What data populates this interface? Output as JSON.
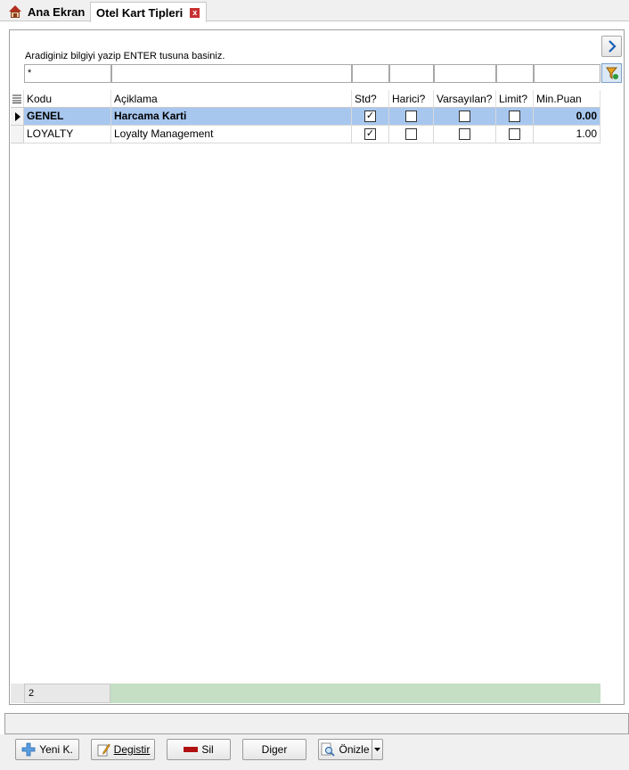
{
  "tabs": {
    "home_label": "Ana Ekran",
    "active_label": "Otel Kart Tipleri",
    "close_glyph": "x"
  },
  "search": {
    "hint": "Aradiginiz bilgiyi yazip ENTER tusuna basiniz.",
    "code_value": "*"
  },
  "grid": {
    "headers": {
      "kodu": "Kodu",
      "aciklama": "Açiklama",
      "std": "Std?",
      "harici": "Harici?",
      "varsayilan": "Varsayılan?",
      "limit": "Limit?",
      "minpuan": "Min.Puan"
    },
    "rows": [
      {
        "kodu": "GENEL",
        "aciklama": "Harcama Karti",
        "std": true,
        "harici": false,
        "varsayilan": false,
        "limit": false,
        "minpuan": "0.00"
      },
      {
        "kodu": "LOYALTY",
        "aciklama": "Loyalty Management",
        "std": true,
        "harici": false,
        "varsayilan": false,
        "limit": false,
        "minpuan": "1.00"
      }
    ],
    "record_count": "2"
  },
  "buttons": {
    "new": "Yeni K.",
    "edit": "Degistir",
    "delete": "Sil",
    "other": "Diger",
    "preview": "Önizle"
  },
  "colors": {
    "selected_row": "#a7c7ef",
    "footer_green": "#c4dfc4",
    "delete_red": "#b01010"
  }
}
